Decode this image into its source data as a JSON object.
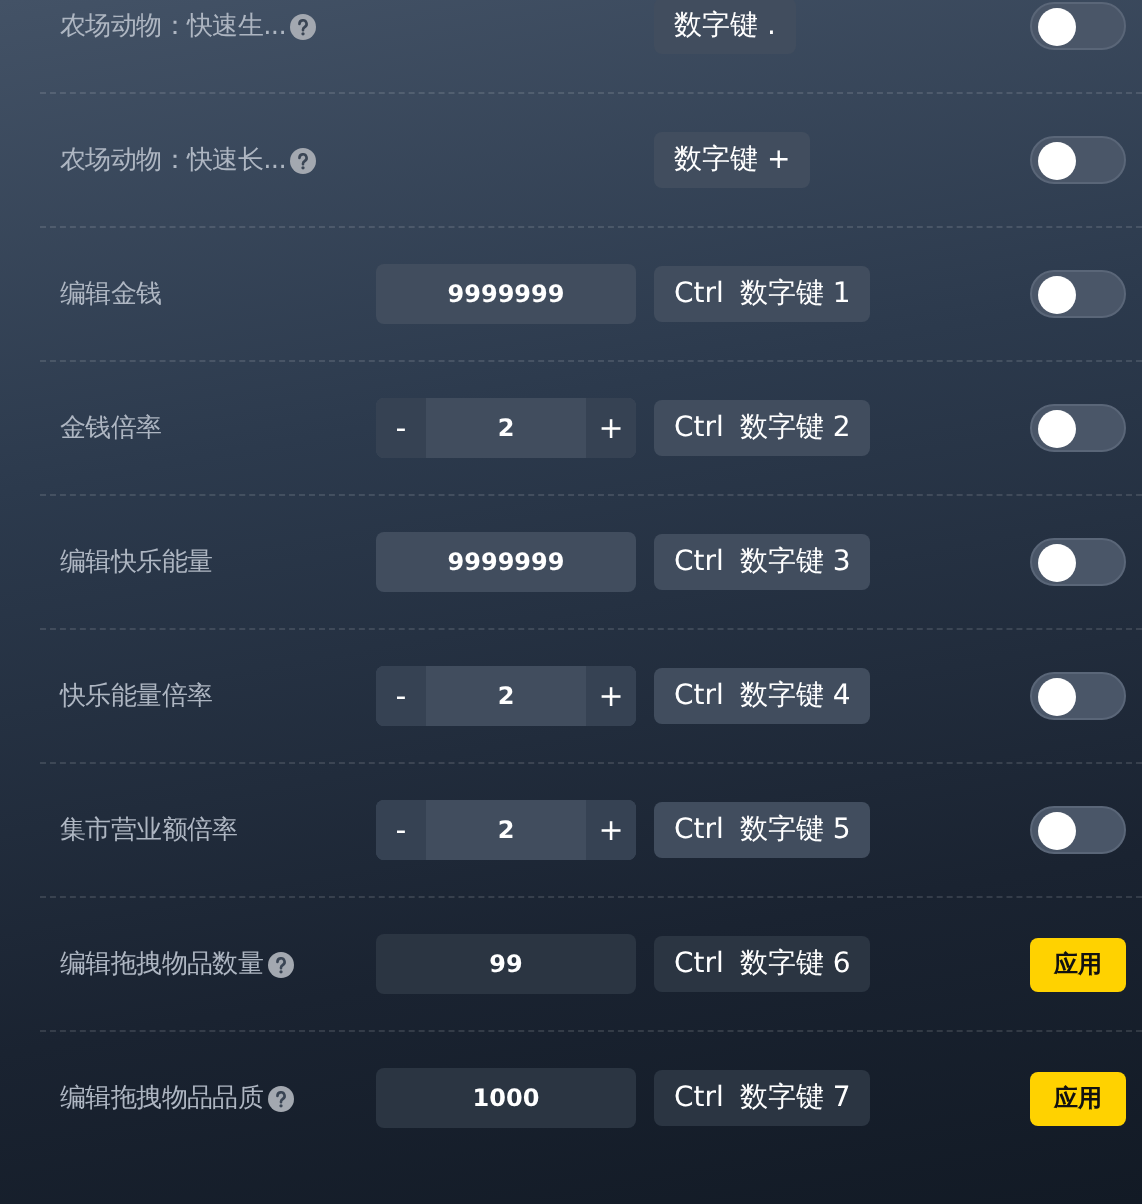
{
  "sections": [
    {
      "rows": [
        {
          "label": "农场动物：快速生...",
          "help": true,
          "control": {
            "kind": "none"
          },
          "hotkey": [
            "数字键 ."
          ],
          "action": {
            "kind": "toggle",
            "on": false
          }
        },
        {
          "label": "农场动物：快速长...",
          "help": true,
          "control": {
            "kind": "none"
          },
          "hotkey": [
            "数字键 +"
          ],
          "action": {
            "kind": "toggle",
            "on": false
          }
        }
      ]
    },
    {
      "rows": [
        {
          "label": "编辑金钱",
          "help": false,
          "control": {
            "kind": "input",
            "value": "9999999"
          },
          "hotkey": [
            "Ctrl",
            "数字键 1"
          ],
          "action": {
            "kind": "toggle",
            "on": false
          }
        },
        {
          "label": "金钱倍率",
          "help": false,
          "control": {
            "kind": "stepper",
            "minus": "-",
            "value": "2",
            "plus": "+"
          },
          "hotkey": [
            "Ctrl",
            "数字键 2"
          ],
          "action": {
            "kind": "toggle",
            "on": false
          }
        },
        {
          "label": "编辑快乐能量",
          "help": false,
          "control": {
            "kind": "input",
            "value": "9999999"
          },
          "hotkey": [
            "Ctrl",
            "数字键 3"
          ],
          "action": {
            "kind": "toggle",
            "on": false
          }
        },
        {
          "label": "快乐能量倍率",
          "help": false,
          "control": {
            "kind": "stepper",
            "minus": "-",
            "value": "2",
            "plus": "+"
          },
          "hotkey": [
            "Ctrl",
            "数字键 4"
          ],
          "action": {
            "kind": "toggle",
            "on": false
          }
        },
        {
          "label": "集市营业额倍率",
          "help": false,
          "control": {
            "kind": "stepper",
            "minus": "-",
            "value": "2",
            "plus": "+"
          },
          "hotkey": [
            "Ctrl",
            "数字键 5"
          ],
          "action": {
            "kind": "toggle",
            "on": false
          }
        },
        {
          "label": "编辑拖拽物品数量",
          "help": true,
          "control": {
            "kind": "input",
            "value": "99"
          },
          "hotkey": [
            "Ctrl",
            "数字键 6"
          ],
          "action": {
            "kind": "apply",
            "label": "应用"
          }
        },
        {
          "label": "编辑拖拽物品品质",
          "help": true,
          "control": {
            "kind": "input",
            "value": "1000"
          },
          "hotkey": [
            "Ctrl",
            "数字键 7"
          ],
          "action": {
            "kind": "apply",
            "label": "应用"
          }
        }
      ]
    }
  ]
}
